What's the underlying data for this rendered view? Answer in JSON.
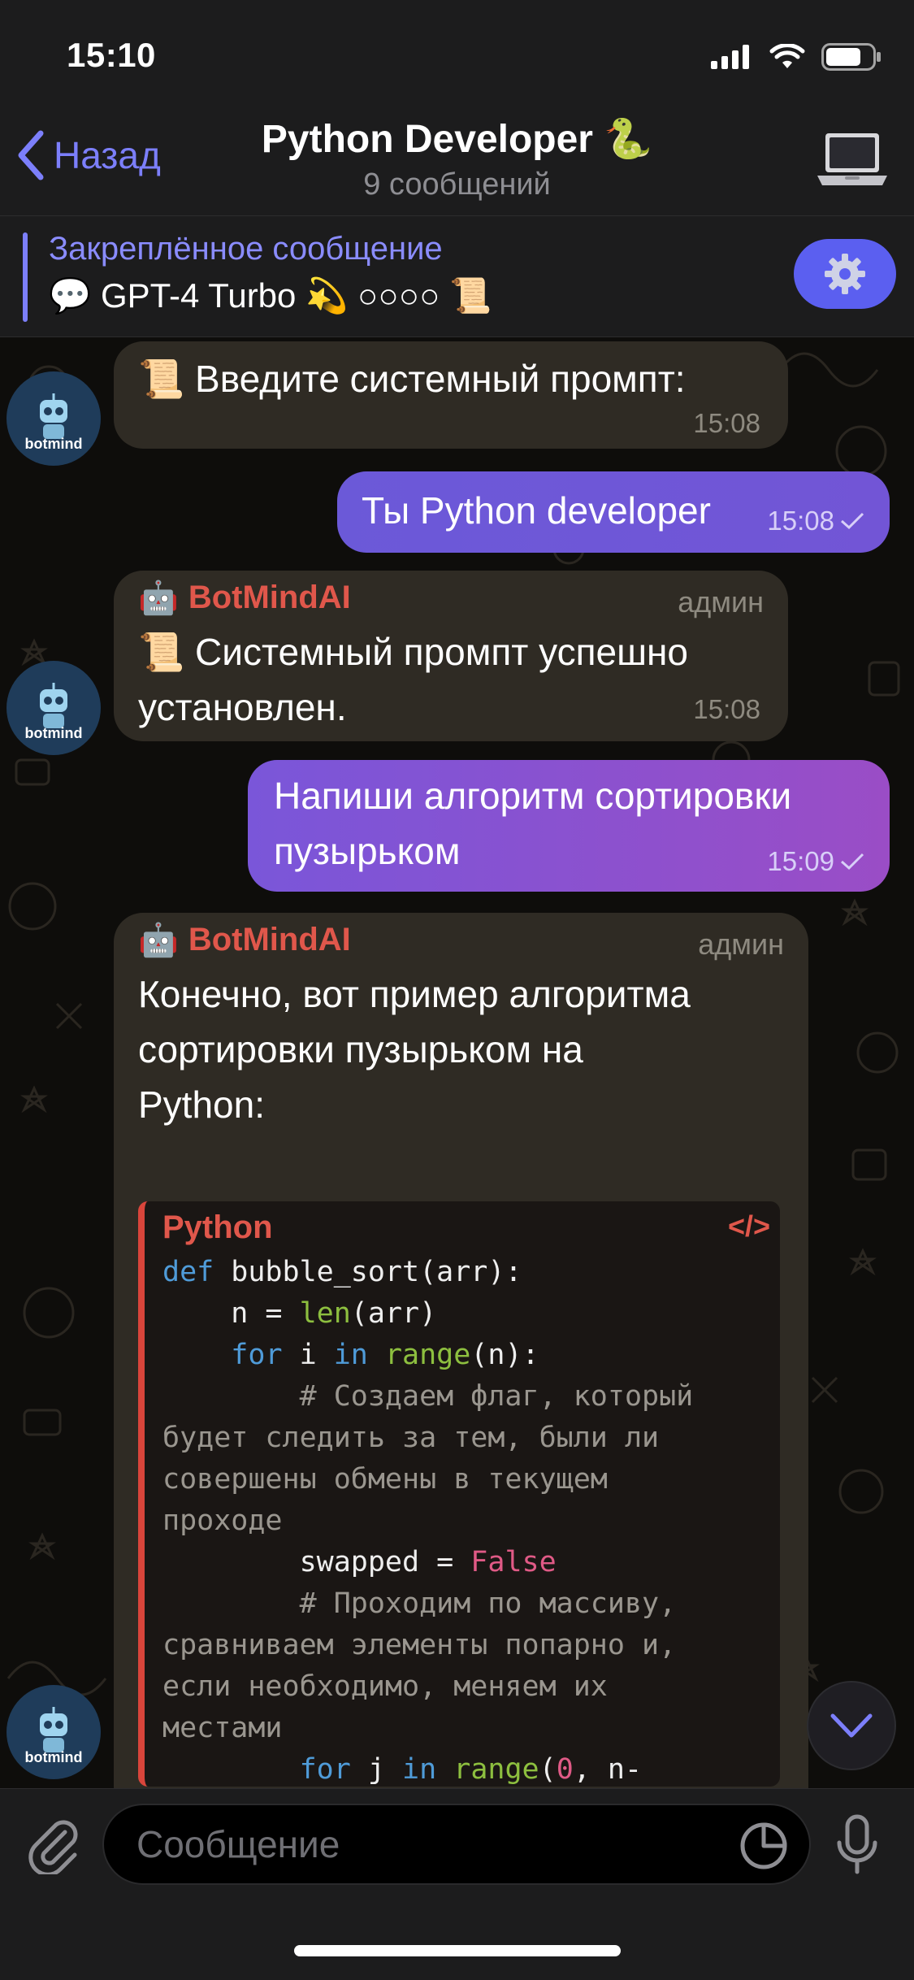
{
  "status": {
    "time": "15:10"
  },
  "header": {
    "back_label": "Назад",
    "title": "Python Developer 🐍",
    "subtitle": "9 сообщений"
  },
  "pinned": {
    "label": "Закреплённое сообщение",
    "text": "💬 GPT-4 Turbo 💫 ○○○○ 📜"
  },
  "messages": [
    {
      "side": "in",
      "text": "📜 Введите системный промпт:",
      "time": "15:08"
    },
    {
      "side": "out",
      "text": "Ты Python developer",
      "time": "15:08"
    },
    {
      "side": "in",
      "sender": "BotMindAI",
      "role": "админ",
      "text_line1": "📜 Системный промпт успешно",
      "text_line2": "установлен.",
      "time": "15:08"
    },
    {
      "side": "out",
      "text_line1": "Напиши алгоритм сортировки",
      "text_line2": "пузырьком",
      "time": "15:09"
    },
    {
      "side": "in",
      "sender": "BotMindAI",
      "role": "админ",
      "text_line1": "Конечно, вот пример алгоритма",
      "text_line2": "сортировки пузырьком на",
      "text_line3": "Python:"
    }
  ],
  "code": {
    "language": "Python",
    "icon": "</>",
    "lines": [
      "def bubble_sort(arr):",
      "    n = len(arr)",
      "    for i in range(n):",
      "        # Создаем флаг, который",
      "будет следить за тем, были ли",
      "совершены обмены в текущем",
      "проходе",
      "        swapped = False",
      "        # Проходим по массиву,",
      "сравниваем элементы попарно и,",
      "если необходимо, меняем их",
      "местами",
      "        for j in range(0, n-"
    ]
  },
  "avatar_label": "botmind",
  "input": {
    "placeholder": "Сообщение"
  },
  "colors": {
    "accent": "#7c7ffb",
    "sender": "#e0574b",
    "bubble_in": "#2f2b24"
  }
}
